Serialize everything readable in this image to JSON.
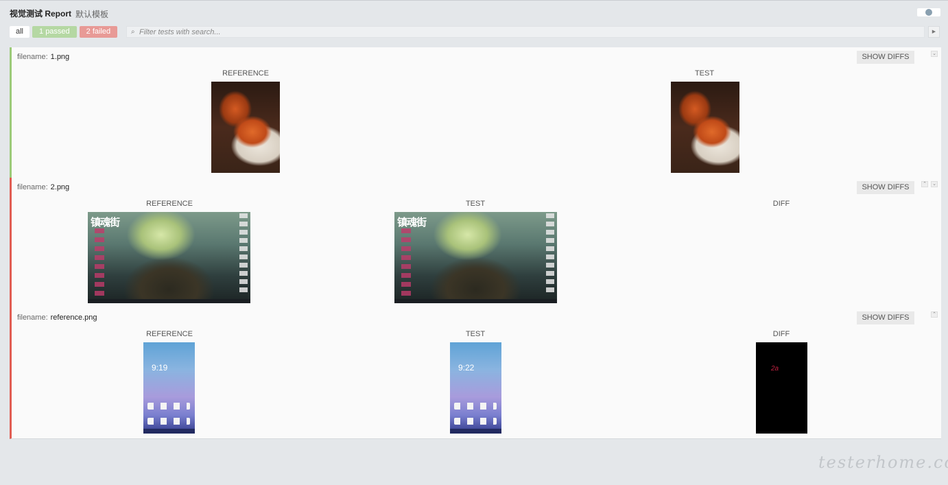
{
  "header": {
    "title": "视觉测试 Report",
    "subtitle": "默认模板"
  },
  "filters": {
    "all": "all",
    "passed": "1 passed",
    "failed": "2 failed",
    "search_placeholder": "Filter tests with search..."
  },
  "tests": [
    {
      "status": "passed",
      "filename_label": "filename:",
      "filename": "1.png",
      "show_diffs": "SHOW DIFFS",
      "columns": [
        "REFERENCE",
        "TEST"
      ]
    },
    {
      "status": "failed",
      "filename_label": "filename:",
      "filename": "2.png",
      "show_diffs": "SHOW DIFFS",
      "columns": [
        "REFERENCE",
        "TEST",
        "DIFF"
      ]
    },
    {
      "status": "failed",
      "filename_label": "filename:",
      "filename": "reference.png",
      "show_diffs": "SHOW DIFFS",
      "columns": [
        "REFERENCE",
        "TEST",
        "DIFF"
      ]
    }
  ],
  "desktop_calligraphy": "镇魂街",
  "phone": {
    "reference_time": "9:19",
    "test_time": "9:22",
    "diff_mark": "2a"
  },
  "icons": {
    "globe": "globe-icon",
    "search": "search-icon",
    "search_button": "toggle-icon",
    "collapse": "chevron-up-icon",
    "expand": "chevron-down-icon"
  },
  "colors": {
    "passed": "#9bca78",
    "failed": "#e05c52",
    "passed_chip": "#b5d8a3",
    "failed_chip": "#e89a96"
  },
  "watermark": "testerhome.com"
}
